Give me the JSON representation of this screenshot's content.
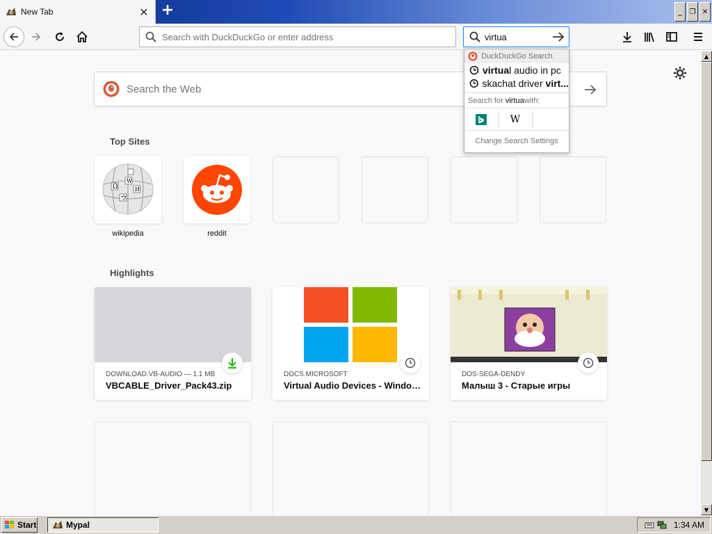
{
  "tab": {
    "title": "New Tab",
    "favicon": "app-favicon"
  },
  "window_controls": {
    "minimize": "_",
    "restore": "❐",
    "close": "✕"
  },
  "navbar": {
    "url_placeholder": "Search with DuckDuckGo or enter address",
    "search_value": "virtua"
  },
  "dropdown": {
    "engine": "DuckDuckGo Search",
    "suggestions": [
      {
        "bold": "virtua",
        "rest": "l audio in pc"
      },
      {
        "bold": "skachat driver ",
        "rest": "virt..."
      }
    ],
    "search_for_prefix": "Search for ",
    "search_for_term": "virtua",
    "search_for_suffix": " with:",
    "engines": [
      "bing",
      "wikipedia"
    ],
    "settings": "Change Search Settings"
  },
  "content": {
    "search_placeholder": "Search the Web",
    "top_sites_title": "Top Sites",
    "top_sites": [
      {
        "label": "wikipedia"
      },
      {
        "label": "reddit"
      }
    ],
    "highlights_title": "Highlights",
    "highlights": [
      {
        "host": "DOWNLOAD.VB-AUDIO — 1.1 MB",
        "title": "VBCABLE_Driver_Pack43.zip",
        "icon": "download-icon"
      },
      {
        "host": "DOCS.MICROSOFT",
        "title": "Virtual Audio Devices - Windows...",
        "icon": "clock-icon"
      },
      {
        "host": "DOS-SEGA-DENDY",
        "title": "Малыш 3 - Старые игры",
        "icon": "clock-icon"
      }
    ]
  },
  "taskbar": {
    "start": "Start",
    "task": "Mypal",
    "clock": "1:34 AM"
  },
  "colors": {
    "accent": "#0a84ff",
    "reddit": "#ff4500",
    "download": "#12bc00"
  }
}
